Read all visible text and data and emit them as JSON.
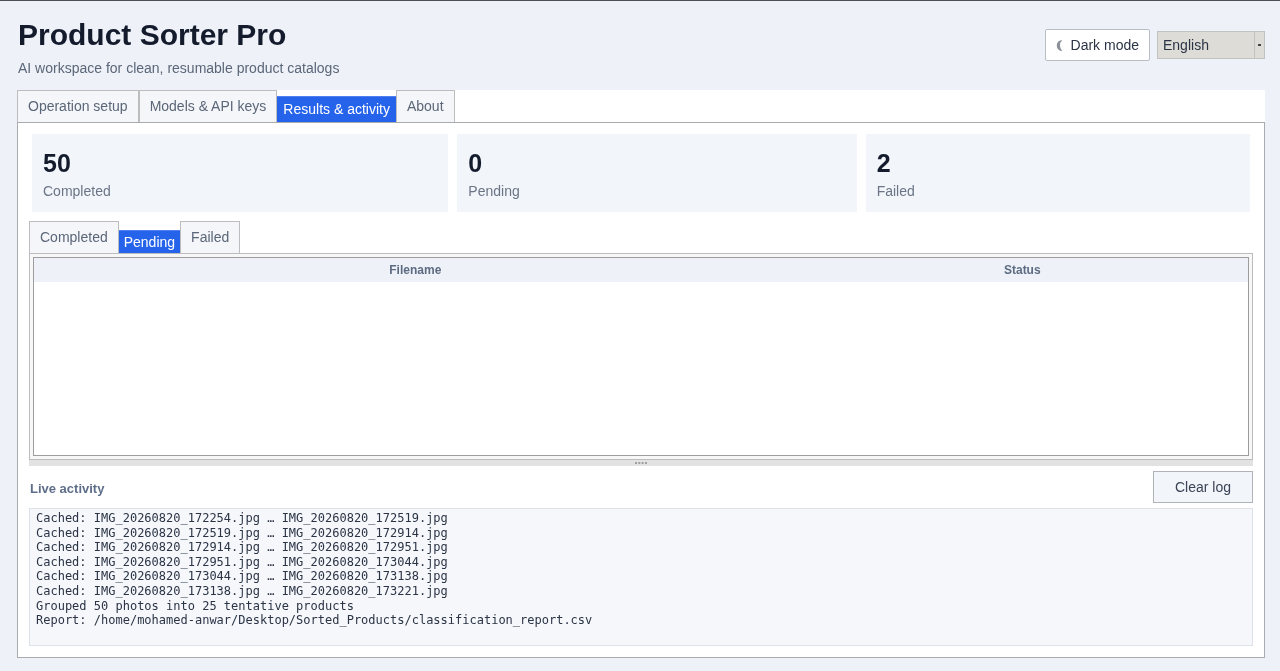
{
  "header": {
    "title": "Product Sorter Pro",
    "subtitle": "AI workspace for clean, resumable product catalogs"
  },
  "controls": {
    "theme_button": "Dark mode",
    "language_select": {
      "value": "English"
    }
  },
  "tabs": [
    {
      "label": "Operation setup",
      "selected": false
    },
    {
      "label": "Models & API keys",
      "selected": false
    },
    {
      "label": "Results & activity",
      "selected": true
    },
    {
      "label": "About",
      "selected": false
    }
  ],
  "stats": [
    {
      "value": "50",
      "label": "Completed"
    },
    {
      "value": "0",
      "label": "Pending"
    },
    {
      "value": "2",
      "label": "Failed"
    }
  ],
  "queue_tabs": [
    {
      "label": "Completed",
      "selected": false
    },
    {
      "label": "Pending",
      "selected": true
    },
    {
      "label": "Failed",
      "selected": false
    }
  ],
  "table": {
    "columns": [
      "Filename",
      "Status"
    ]
  },
  "activity": {
    "title": "Live activity",
    "clear_button": "Clear log",
    "log_lines": [
      "Cached: IMG_20260820_172254.jpg … IMG_20260820_172519.jpg",
      "Cached: IMG_20260820_172519.jpg … IMG_20260820_172914.jpg",
      "Cached: IMG_20260820_172914.jpg … IMG_20260820_172951.jpg",
      "Cached: IMG_20260820_172951.jpg … IMG_20260820_173044.jpg",
      "Cached: IMG_20260820_173044.jpg … IMG_20260820_173138.jpg",
      "Cached: IMG_20260820_173138.jpg … IMG_20260820_173221.jpg",
      "Grouped 50 photos into 25 tentative products",
      "Report: /home/mohamed-anwar/Desktop/Sorted_Products/classification_report.csv"
    ]
  }
}
